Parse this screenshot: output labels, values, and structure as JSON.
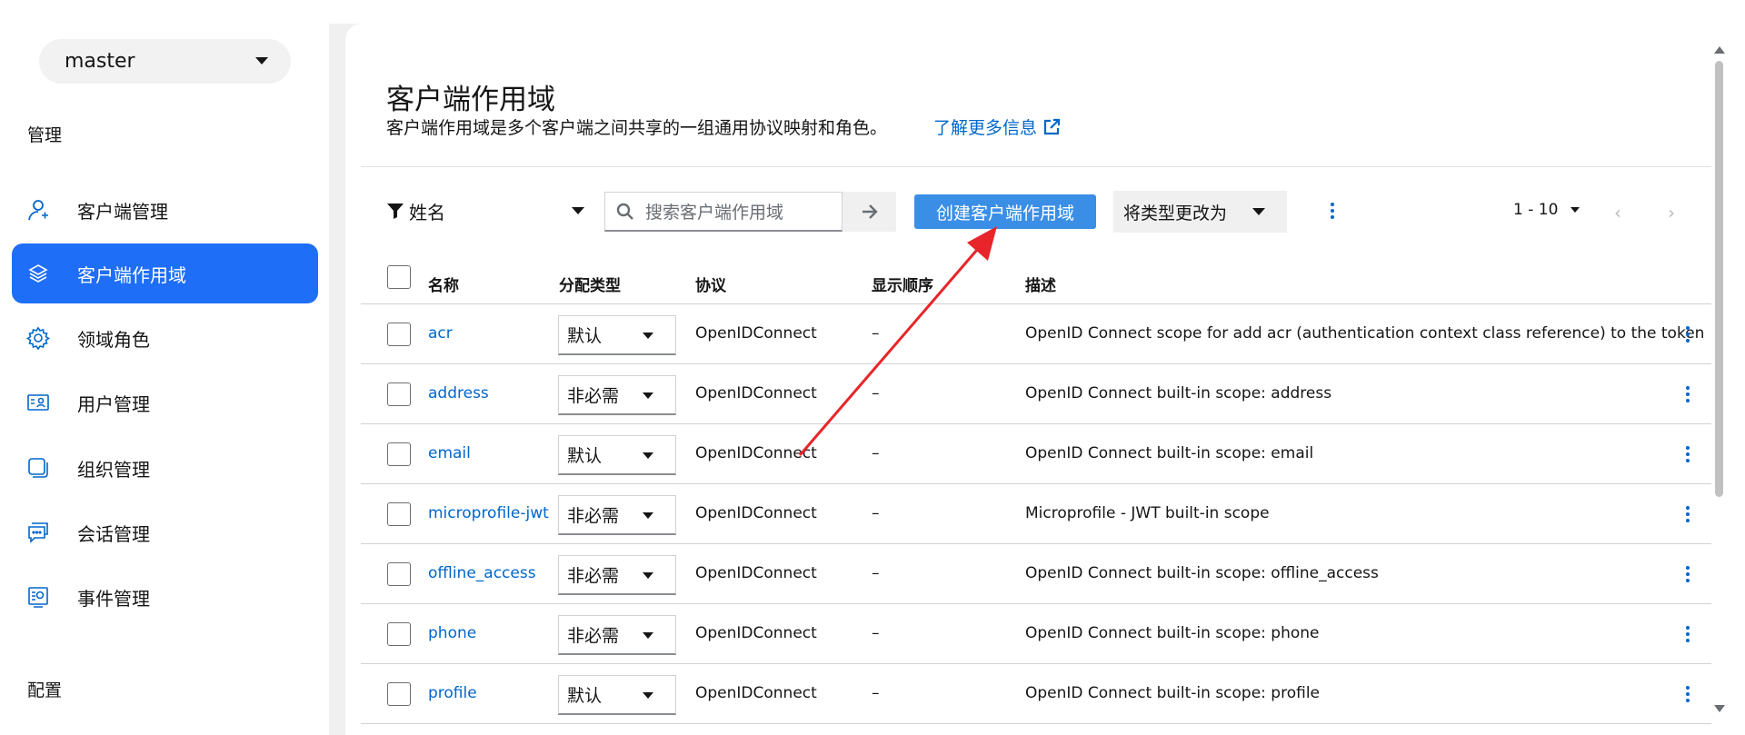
{
  "sidebar": {
    "realm": "master",
    "sections": {
      "manage": "管理",
      "configure": "配置"
    },
    "items": [
      {
        "label": "客户端管理",
        "icon": "user-icon"
      },
      {
        "label": "客户端作用域",
        "icon": "layers-icon"
      },
      {
        "label": "领域角色",
        "icon": "gear-icon"
      },
      {
        "label": "用户管理",
        "icon": "id-card-icon"
      },
      {
        "label": "组织管理",
        "icon": "organization-icon"
      },
      {
        "label": "会话管理",
        "icon": "chat-icon"
      },
      {
        "label": "事件管理",
        "icon": "event-icon"
      }
    ]
  },
  "page": {
    "title": "客户端作用域",
    "description": "客户端作用域是多个客户端之间共享的一组通用协议映射和角色。",
    "learn_more": "了解更多信息"
  },
  "toolbar": {
    "filter_label": "姓名",
    "search_placeholder": "搜索客户端作用域",
    "create_label": "创建客户端作用域",
    "change_type_label": "将类型更改为",
    "pagination": "1 - 10"
  },
  "table": {
    "headers": {
      "name": "名称",
      "assign": "分配类型",
      "protocol": "协议",
      "order": "显示顺序",
      "description": "描述"
    },
    "rows": [
      {
        "name": "acr",
        "assign": "默认",
        "protocol": "OpenIDConnect",
        "order": "–",
        "description": "OpenID Connect scope for add acr (authentication context class reference) to the token"
      },
      {
        "name": "address",
        "assign": "非必需",
        "protocol": "OpenIDConnect",
        "order": "–",
        "description": "OpenID Connect built-in scope: address"
      },
      {
        "name": "email",
        "assign": "默认",
        "protocol": "OpenIDConnect",
        "order": "–",
        "description": "OpenID Connect built-in scope: email"
      },
      {
        "name": "microprofile-jwt",
        "assign": "非必需",
        "protocol": "OpenIDConnect",
        "order": "–",
        "description": "Microprofile - JWT built-in scope"
      },
      {
        "name": "offline_access",
        "assign": "非必需",
        "protocol": "OpenIDConnect",
        "order": "–",
        "description": "OpenID Connect built-in scope: offline_access"
      },
      {
        "name": "phone",
        "assign": "非必需",
        "protocol": "OpenIDConnect",
        "order": "–",
        "description": "OpenID Connect built-in scope: phone"
      },
      {
        "name": "profile",
        "assign": "默认",
        "protocol": "OpenIDConnect",
        "order": "–",
        "description": "OpenID Connect built-in scope: profile"
      }
    ]
  },
  "colors": {
    "accent": "#1f6ef8",
    "link": "#0066cc",
    "annotation": "#e8252a"
  }
}
